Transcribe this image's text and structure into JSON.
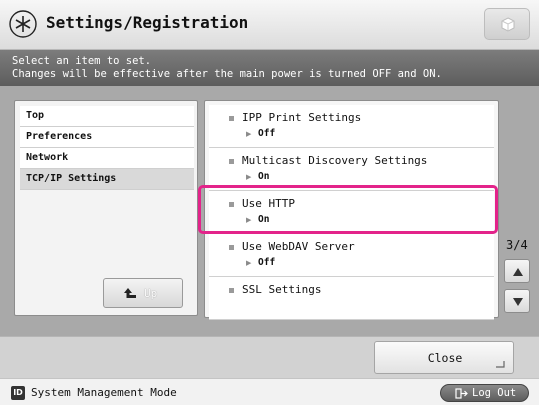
{
  "header": {
    "title": "Settings/Registration",
    "icon": "settings-asterisk-icon",
    "right_button_icon": "cube-icon"
  },
  "instruction": {
    "line1": "Select an item to set.",
    "line2": "Changes will be effective after the main power is turned OFF and ON."
  },
  "nav": {
    "items": [
      {
        "label": "Top",
        "selected": false
      },
      {
        "label": "Preferences",
        "selected": false
      },
      {
        "label": "Network",
        "selected": false
      },
      {
        "label": "TCP/IP Settings",
        "selected": true
      }
    ],
    "up_label": "Up",
    "up_icon": "up-arrow-icon"
  },
  "list": {
    "items": [
      {
        "label": "IPP Print Settings",
        "value": "Off"
      },
      {
        "label": "Multicast Discovery Settings",
        "value": "On"
      },
      {
        "label": "Use HTTP",
        "value": "On",
        "highlighted": true
      },
      {
        "label": "Use WebDAV Server",
        "value": "Off"
      },
      {
        "label": "SSL Settings",
        "value": ""
      }
    ]
  },
  "pagination": {
    "counter": "3/4",
    "up_icon": "triangle-up-icon",
    "down_icon": "triangle-down-icon"
  },
  "footer": {
    "close_label": "Close"
  },
  "status": {
    "id_badge": "ID",
    "mode_text": "System Management Mode",
    "logout_label": "Log Out",
    "logout_icon": "logout-icon"
  },
  "colors": {
    "highlight": "#e3238a",
    "main_background": "#a9a9a9",
    "instruction_background": "#6e6e6e"
  }
}
